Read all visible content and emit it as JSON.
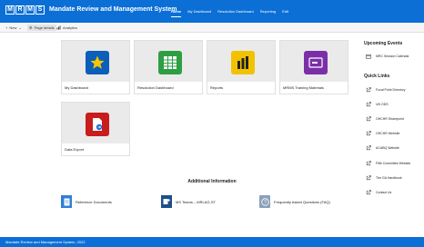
{
  "header": {
    "logo_letters": [
      "M",
      "R",
      "M",
      "S"
    ],
    "title": "Mandate Review and Management System",
    "nav": [
      "Home",
      "My Dashboard",
      "Resolution Dashboard",
      "Reporting",
      "Edit"
    ],
    "active_nav": "Home",
    "brand_color": "#0b6fd6"
  },
  "command_bar": {
    "new_label": "New",
    "page_details_label": "Page details",
    "analytics_label": "Analytics"
  },
  "tiles": [
    {
      "label": "My Dashboard",
      "icon": "star-icon",
      "color": "#0b5fb8"
    },
    {
      "label": "Resolution Dashboard",
      "icon": "spreadsheet-icon",
      "color": "#2e9e43"
    },
    {
      "label": "Reports",
      "icon": "powerbi-icon",
      "color": "#f2c200"
    },
    {
      "label": "MRMS Training Materials",
      "icon": "video-card-icon",
      "color": "#7a2fa8"
    },
    {
      "label": "Data Export",
      "icon": "document-export-icon",
      "color": "#c91c1c"
    }
  ],
  "additional": {
    "title": "Additional Information",
    "links": [
      {
        "label": "Reference Documents",
        "icon": "document-icon"
      },
      {
        "label": "MS Teams – MRLAG-ST",
        "icon": "teams-icon"
      },
      {
        "label": "Frequently Asked Questions (FAQ)",
        "icon": "faq-icon"
      }
    ]
  },
  "sidebar": {
    "upcoming_title": "Upcoming Events",
    "upcoming_items": [
      {
        "label": "MRC Session Calendar",
        "icon": "calendar-icon"
      }
    ],
    "quick_links_title": "Quick Links",
    "quick_links": [
      "Focal Point Directory",
      "UN ODS",
      "OHCHR Sharepoint",
      "OHCHR Website",
      "ACABQ Website",
      "Fifth Committee Website",
      "The GA Handbook",
      "Contact Us"
    ]
  },
  "footer": {
    "text": "Mandate Review and Management System, 2022"
  }
}
